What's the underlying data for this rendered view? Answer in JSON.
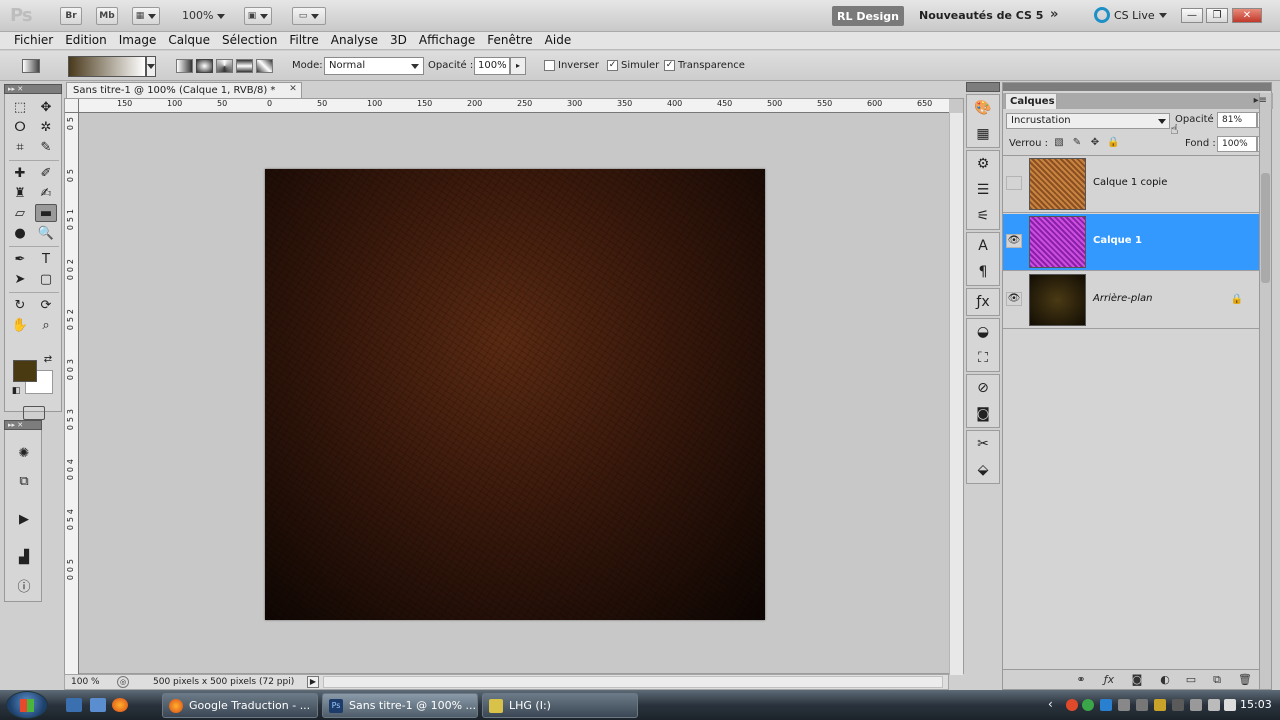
{
  "app": {
    "logo": "Ps",
    "app_buttons": [
      "Br",
      "Mb"
    ],
    "zoom": "100%",
    "workspaces": {
      "active": "RL Design",
      "next": "Nouveautés de CS 5",
      "more": "»"
    },
    "cs_live": "CS Live",
    "window_controls": {
      "minimize": "—",
      "restore": "❐",
      "close": "✕"
    }
  },
  "menu": [
    "Fichier",
    "Edition",
    "Image",
    "Calque",
    "Sélection",
    "Filtre",
    "Analyse",
    "3D",
    "Affichage",
    "Fenêtre",
    "Aide"
  ],
  "options": {
    "mode_label": "Mode:",
    "mode_value": "Normal",
    "opacity_label": "Opacité :",
    "opacity_value": "100%",
    "opacity_arrow": "▸",
    "checks": [
      {
        "label": "Inverser",
        "checked": false,
        "mark": ""
      },
      {
        "label": "Simuler",
        "checked": true,
        "mark": "✓"
      },
      {
        "label": "Transparence",
        "checked": true,
        "mark": "✓"
      }
    ]
  },
  "toolbox": {
    "header": "▸▸ ✕",
    "sub_header": "▸▸ ✕"
  },
  "document": {
    "tab_title": "Sans titre-1 @ 100% (Calque 1, RVB/8) *",
    "tab_close": "✕",
    "ruler_h": [
      "150",
      "100",
      "50",
      "0",
      "50",
      "100",
      "150",
      "200",
      "250",
      "300",
      "350",
      "400",
      "450",
      "500",
      "550",
      "600",
      "650"
    ],
    "ruler_v": [
      "5",
      "0",
      "5",
      "0",
      "1",
      "5",
      "0",
      "2",
      "0",
      "0",
      "2",
      "5",
      "0",
      "3",
      "0",
      "0",
      "3",
      "5",
      "0",
      "4",
      "0",
      "0",
      "4",
      "5",
      "0",
      "5",
      "0",
      "0"
    ],
    "zoom": "100 %",
    "size_info": "500 pixels x 500 pixels (72 ppi)",
    "status_arrow": "▶"
  },
  "layers_panel": {
    "tab": "Calques",
    "menu_icon": "▸≡",
    "blend_mode": "Incrustation",
    "opacity_label": "Opacité :",
    "opacity_value": "81%",
    "lock_label": "Verrou :",
    "fill_label": "Fond :",
    "fill_value": "100%",
    "spin_arrow": "▸",
    "layers": [
      {
        "name": "Calque 1 copie",
        "visible": false,
        "eye": "",
        "selected": false,
        "thumb": "#b5703a"
      },
      {
        "name": "Calque 1",
        "visible": true,
        "eye": "👁",
        "selected": true,
        "thumb": "#b23ad0"
      },
      {
        "name": "Arrière-plan",
        "visible": true,
        "eye": "👁",
        "selected": false,
        "thumb": "#2e220c",
        "locked": true,
        "lock": "🔒"
      }
    ],
    "footer_icons": [
      "link-icon",
      "fx-icon",
      "mask-icon",
      "adjustment-icon",
      "group-icon",
      "new-layer-icon",
      "trash-icon"
    ]
  },
  "taskbar": {
    "items": [
      {
        "label": "Google Traduction - ...",
        "active": false
      },
      {
        "label": "Sans titre-1 @ 100% ...",
        "active": true
      },
      {
        "label": "LHG (I:)",
        "active": false
      }
    ],
    "tray_arrow": "‹",
    "time": "15:03"
  },
  "colors": {
    "foreground": "#4a3a12",
    "background": "#ffffff",
    "selection": "#3399ff"
  }
}
